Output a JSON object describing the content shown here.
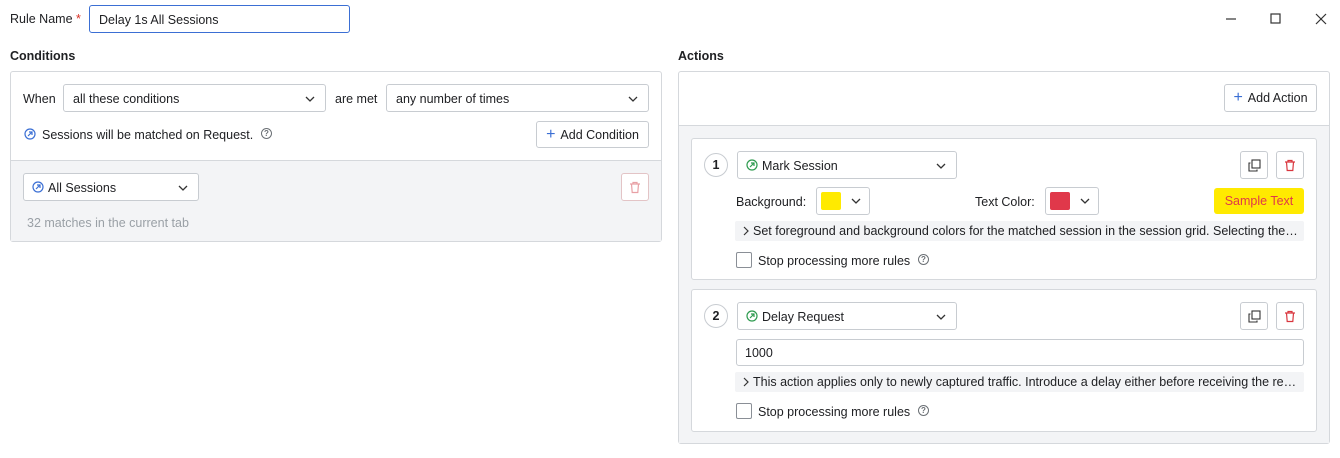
{
  "header": {
    "rule_name_label": "Rule Name",
    "required_mark": "*",
    "rule_name_value": "Delay 1s All Sessions"
  },
  "window_controls": {
    "minimize": "minimize-icon",
    "maximize": "maximize-icon",
    "close": "close-icon"
  },
  "conditions": {
    "title": "Conditions",
    "when_label": "When",
    "match_mode": "all these conditions",
    "are_met_label": "are met",
    "frequency": "any number of times",
    "match_note": "Sessions will be matched on Request.",
    "add_condition_label": "Add Condition",
    "condition_items": [
      {
        "value": "All Sessions",
        "matches_text": "32 matches in the current tab"
      }
    ]
  },
  "actions": {
    "title": "Actions",
    "add_action_label": "Add Action",
    "items": [
      {
        "number": "1",
        "type": "Mark Session",
        "background_label": "Background:",
        "background_color": "#ffea00",
        "text_color_label": "Text Color:",
        "text_color": "#e0384a",
        "sample_text": "Sample Text",
        "description": "Set foreground and background colors for the matched session in the session grid. Selecting the same color for background and text will reset the colors.",
        "stop_label": "Stop processing more rules"
      },
      {
        "number": "2",
        "type": "Delay Request",
        "delay_value": "1000",
        "description": "This action applies only to newly captured traffic. Introduce a delay either before receiving the request or before sending the response.",
        "stop_label": "Stop processing more rules"
      }
    ]
  },
  "colors": {
    "accent": "#3b6fd4",
    "required": "#d93025",
    "delete": "#d9363e",
    "action_icon": "#2e9b4f",
    "border": "#d5d8dc"
  }
}
